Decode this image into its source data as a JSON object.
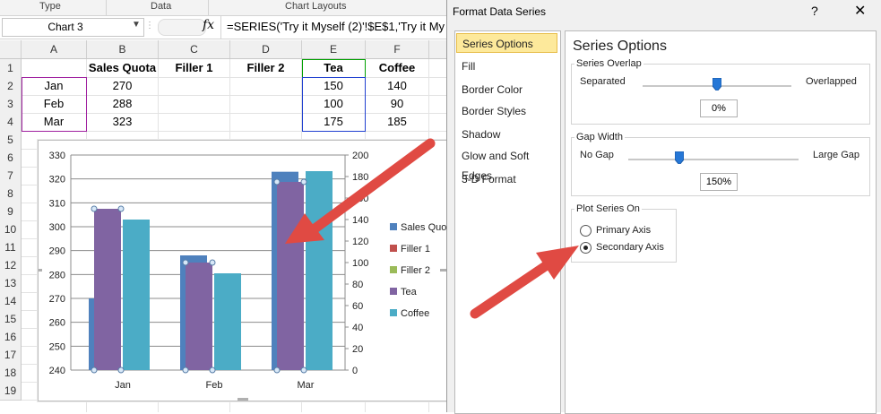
{
  "ribbon": {
    "groups": [
      "Type",
      "Data",
      "Chart Layouts"
    ]
  },
  "formula_bar": {
    "name_box": "Chart 3",
    "fx": "fx",
    "formula": "=SERIES('Try it Myself (2)'!$E$1,'Try it My"
  },
  "sheet": {
    "columns": [
      "A",
      "B",
      "C",
      "D",
      "E",
      "F"
    ],
    "rows": [
      "1",
      "2",
      "3",
      "4",
      "5",
      "6",
      "7",
      "8",
      "9",
      "10",
      "11",
      "12",
      "13",
      "14",
      "15",
      "16",
      "17",
      "18",
      "19"
    ],
    "headers": {
      "B": "Sales Quota",
      "C": "Filler 1",
      "D": "Filler 2",
      "E": "Tea",
      "F": "Coffee"
    },
    "data": [
      {
        "A": "Jan",
        "B": "270",
        "E": "150",
        "F": "140"
      },
      {
        "A": "Feb",
        "B": "288",
        "E": "100",
        "F": "90"
      },
      {
        "A": "Mar",
        "B": "323",
        "E": "175",
        "F": "185"
      }
    ]
  },
  "chart_data": {
    "type": "bar",
    "categories": [
      "Jan",
      "Feb",
      "Mar"
    ],
    "series": [
      {
        "name": "Sales Quota",
        "values": [
          270,
          288,
          323
        ],
        "axis": "primary",
        "color": "#4f81bd"
      },
      {
        "name": "Filler 1",
        "values": [
          0,
          0,
          0
        ],
        "axis": "primary",
        "color": "#c0504d"
      },
      {
        "name": "Filler 2",
        "values": [
          0,
          0,
          0
        ],
        "axis": "primary",
        "color": "#9bbb59"
      },
      {
        "name": "Tea",
        "values": [
          150,
          100,
          175
        ],
        "axis": "secondary",
        "color": "#8064a2"
      },
      {
        "name": "Coffee",
        "values": [
          140,
          90,
          185
        ],
        "axis": "secondary",
        "color": "#4bacc6"
      }
    ],
    "y_primary": {
      "ticks": [
        "240",
        "250",
        "260",
        "270",
        "280",
        "290",
        "300",
        "310",
        "320",
        "330"
      ],
      "ylim": [
        240,
        330
      ]
    },
    "y_secondary": {
      "ticks": [
        "0",
        "20",
        "40",
        "60",
        "80",
        "100",
        "120",
        "140",
        "160",
        "180",
        "200"
      ],
      "ylim": [
        0,
        200
      ]
    },
    "legend_placement": "right",
    "grid": true,
    "selected_series": "Tea"
  },
  "dialog": {
    "title": "Format Data Series",
    "help": "?",
    "close": "✕",
    "nav": [
      "Series Options",
      "Fill",
      "Border Color",
      "Border Styles",
      "Shadow",
      "Glow and Soft Edges",
      "3-D Format"
    ],
    "selected_nav": "Series Options",
    "content_title": "Series Options",
    "overlap": {
      "label": "Series Overlap",
      "left": "Separated",
      "right": "Overlapped",
      "value": "0%",
      "fraction": 0.5
    },
    "gap": {
      "label": "Gap Width",
      "left": "No Gap",
      "right": "Large Gap",
      "value": "150%",
      "fraction": 0.3
    },
    "plot_on": {
      "label": "Plot Series On",
      "options": [
        "Primary Axis",
        "Secondary Axis"
      ],
      "selected": "Secondary Axis"
    }
  },
  "colors": {
    "arrow": "#e04a43",
    "selection_purple": "#a020a0",
    "selection_green": "#00a000",
    "selection_blue": "#2040d0"
  }
}
